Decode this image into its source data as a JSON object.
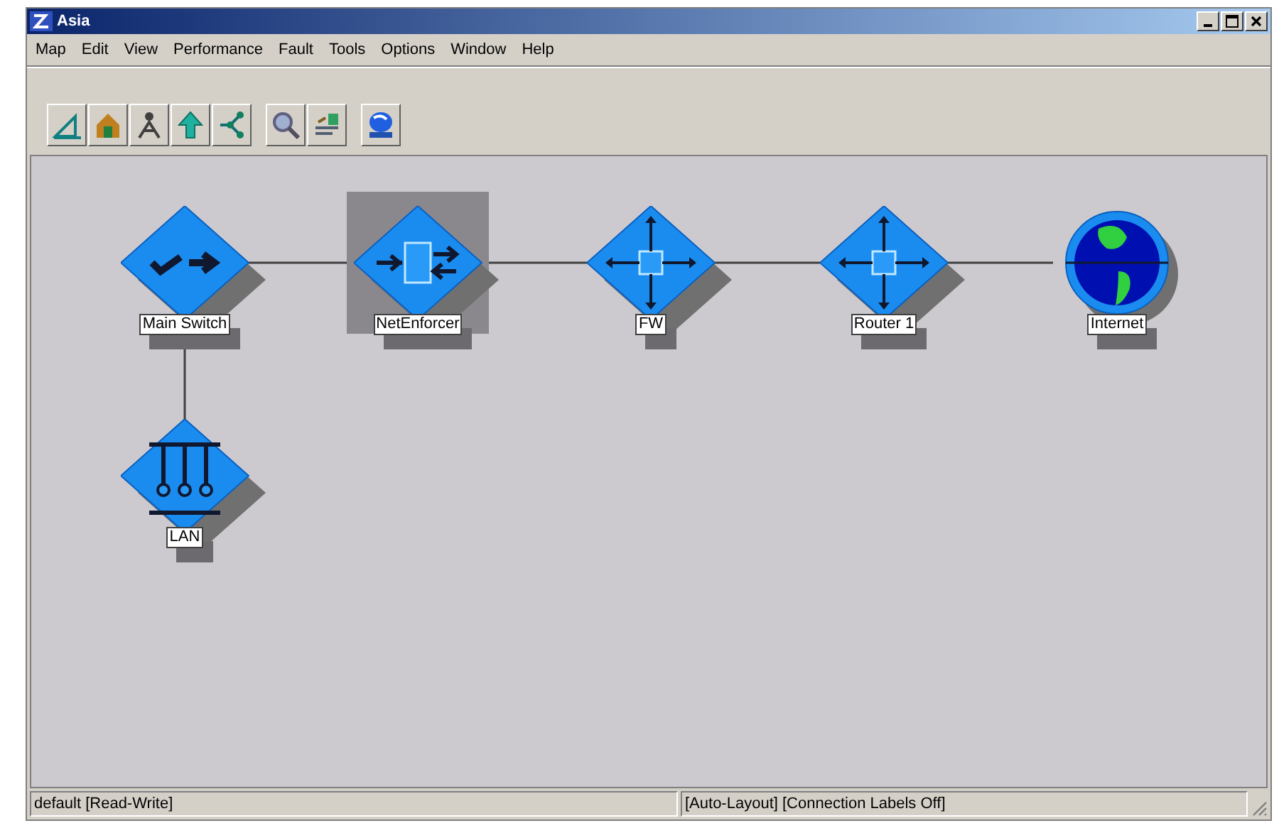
{
  "window": {
    "title": "Asia"
  },
  "menu": [
    "Map",
    "Edit",
    "View",
    "Performance",
    "Fault",
    "Tools",
    "Options",
    "Window",
    "Help"
  ],
  "map": {
    "nodes": [
      {
        "label": "Main Switch",
        "kind": "switch",
        "selected": false,
        "children": [
          {
            "label": "NetEnforcer",
            "kind": "enforcer",
            "selected": true,
            "children": [
              {
                "label": "FW",
                "kind": "router",
                "selected": false,
                "children": [
                  {
                    "label": "Router 1",
                    "kind": "router",
                    "selected": false,
                    "children": [
                      {
                        "label": "Internet",
                        "kind": "globe",
                        "selected": false
                      }
                    ]
                  }
                ]
              }
            ]
          },
          {
            "label": "LAN",
            "kind": "hub",
            "selected": false
          }
        ]
      }
    ]
  },
  "status_bar": [
    "default [Read-Write]",
    "[Auto-Layout] [Connection Labels Off]"
  ]
}
